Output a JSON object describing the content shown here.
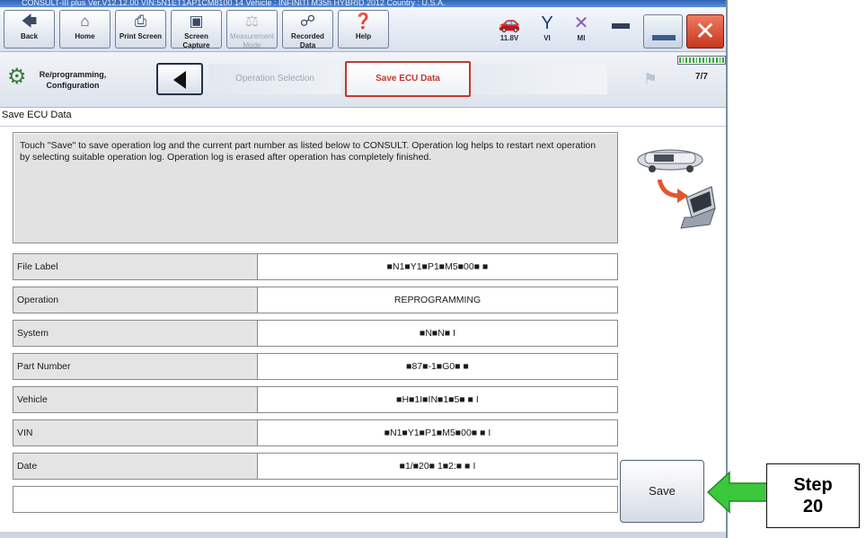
{
  "window": {
    "title_text": "CONSULT-III plus   Ver.V12.12.00        VIN:5N1ET1AP1CM8100 14              Vehicle : INFINITI M35h HYBRID 2012          Country : U.S.A."
  },
  "toolbar": {
    "buttons": [
      {
        "label": "Back",
        "icon": "back-arrow-icon"
      },
      {
        "label": "Home",
        "icon": "home-icon"
      },
      {
        "label": "Print Screen",
        "icon": "printer-icon"
      },
      {
        "label": "Screen Capture",
        "icon": "camera-icon"
      },
      {
        "label": "Measurement Mode",
        "icon": "measurement-icon"
      },
      {
        "label": "Recorded Data",
        "icon": "recorded-data-icon"
      },
      {
        "label": "Help",
        "icon": "help-icon"
      }
    ],
    "status": [
      {
        "label": "11.8V",
        "icon": "car-battery-icon"
      },
      {
        "label": "VI",
        "icon": "vi-antenna-icon"
      },
      {
        "label": "MI",
        "icon": "mi-x-icon"
      }
    ]
  },
  "nav": {
    "config_label": "Re/programming, Configuration",
    "crumb_operation": "Operation Selection",
    "crumb_save": "Save ECU Data",
    "progress": {
      "text": "7/7",
      "done": 7,
      "total": 7
    }
  },
  "page": {
    "title": "Save ECU Data",
    "message": "Touch \"Save\" to save operation log and the current part number as listed below to CONSULT. Operation log helps to restart next operation by selecting suitable operation log. Operation log is erased after operation has completely finished."
  },
  "table": {
    "rows": [
      {
        "label": "File Label",
        "value": "■N1■Y1■P1■M5■00■  ■"
      },
      {
        "label": "Operation",
        "value": "REPROGRAMMING"
      },
      {
        "label": "System",
        "value": "■N■N■  I"
      },
      {
        "label": "Part Number",
        "value": "■87■-1■G0■  ■"
      },
      {
        "label": "Vehicle",
        "value": "■H■1I■IN■1■5■  ■  I"
      },
      {
        "label": "VIN",
        "value": "■N1■Y1■P1■M5■00■  ■  I"
      },
      {
        "label": "Date",
        "value": "■1/■20■ 1■2:■  ■  I"
      }
    ]
  },
  "actions": {
    "save_label": "Save"
  },
  "callout": {
    "line1": "Step",
    "line2": "20",
    "arrow_color": "#3cc83c"
  },
  "colors": {
    "accent_red": "#c0392f",
    "progress_green": "#34a532"
  }
}
